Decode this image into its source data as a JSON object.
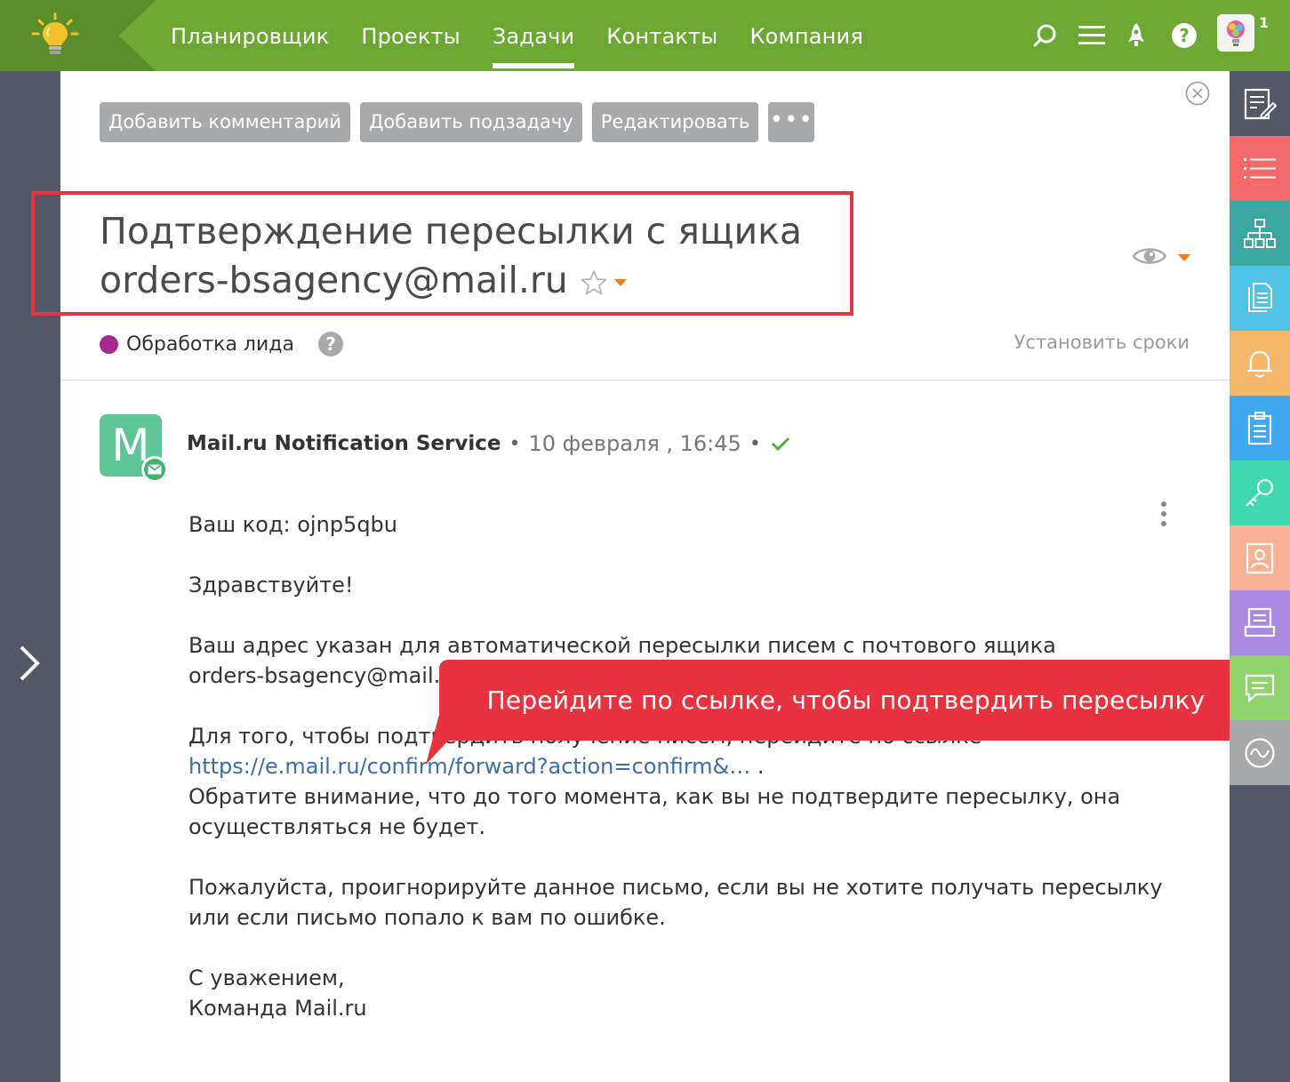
{
  "nav": {
    "items": [
      "Планировщик",
      "Проекты",
      "Задачи",
      "Контакты",
      "Компания"
    ],
    "active_index": 2
  },
  "user": {
    "notifications": "1"
  },
  "actions": {
    "add_comment": "Добавить комментарий",
    "add_subtask": "Добавить подзадачу",
    "edit": "Редактировать",
    "more": "•••"
  },
  "task": {
    "title_line1": "Подтверждение пересылки с ящика",
    "title_line2": "orders-bsagency@mail.ru",
    "status": "Обработка лида",
    "status_color": "#a9288f",
    "help": "?",
    "set_dates": "Установить сроки"
  },
  "message": {
    "avatar_letter": "M",
    "author": "Mail.ru Notification Service",
    "separator": "•",
    "date": "10 февраля , 16:45",
    "body": {
      "code_line": "Ваш код: ojnp5qbu",
      "greeting": "Здравствуйте!",
      "forward_line1": "Ваш адрес указан для автоматической пересылки писем с почтового ящика",
      "forward_line2": "orders-bsagency@mail.ru.",
      "confirm_intro": "Для того, чтобы подтвердить получение писем, перейдите по ссылке",
      "confirm_link": "https://e.mail.ru/confirm/forward?action=confirm&…",
      "confirm_link_suffix": " .",
      "notice": "Обратите внимание, что до того момента, как вы не подтвердите пересылку, она осуществляться не будет.",
      "ignore": "Пожалуйста, проигнорируйте данное письмо, если вы не хотите получать пересылку или если письмо попало к вам по ошибке.",
      "regards": "С уважением,",
      "signature": "Команда Mail.ru"
    }
  },
  "callout": {
    "text": "Перейдите по ссылке, чтобы подтвердить пересылку",
    "color": "#e8333f"
  },
  "right_rail": {
    "items": [
      {
        "icon": "edit-note-icon",
        "color": "#545765"
      },
      {
        "icon": "list-icon",
        "color": "#f46a6a"
      },
      {
        "icon": "hierarchy-icon",
        "color": "#3aa7a3"
      },
      {
        "icon": "documents-icon",
        "color": "#4fc4e6"
      },
      {
        "icon": "bell-icon",
        "color": "#f5b86a"
      },
      {
        "icon": "clipboard-icon",
        "color": "#3ea8f0"
      },
      {
        "icon": "key-icon",
        "color": "#3fd9b0"
      },
      {
        "icon": "contact-card-icon",
        "color": "#fbb193"
      },
      {
        "icon": "printer-icon",
        "color": "#a98ae0"
      },
      {
        "icon": "chat-icon",
        "color": "#8ed46b"
      },
      {
        "icon": "activity-icon",
        "color": "#a8a9ab"
      }
    ]
  },
  "colors": {
    "topbar": "#6da832",
    "logo_bg": "#5a8e28",
    "rail_bg": "#545765",
    "accent_orange": "#f07d16",
    "highlight_red": "#e8333f"
  }
}
